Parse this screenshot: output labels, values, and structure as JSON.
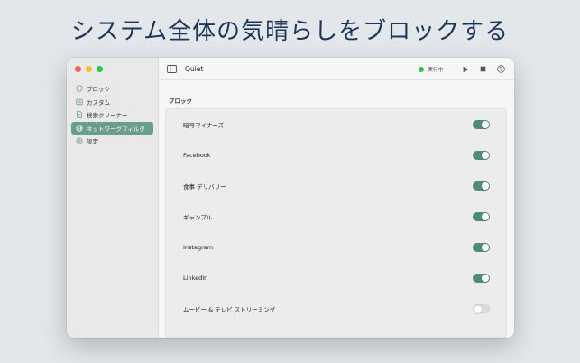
{
  "headline": "システム全体の気晴らしをブロックする",
  "colors": {
    "accent": "#6b9d8e",
    "toggle_on": "#4f8b7b",
    "status_running": "#2ec44a"
  },
  "sidebar": {
    "items": [
      {
        "label": "ブロック",
        "icon": "shield-icon"
      },
      {
        "label": "カスタム",
        "icon": "list-icon"
      },
      {
        "label": "検索クリーナー",
        "icon": "document-icon"
      },
      {
        "label": "ネットワークフィルタ",
        "icon": "globe-icon",
        "active": true
      },
      {
        "label": "設定",
        "icon": "gear-icon"
      }
    ]
  },
  "toolbar": {
    "title": "Quiet",
    "status": "実行中",
    "icons": [
      "sidebar-toggle-icon",
      "play-icon",
      "stop-icon",
      "help-icon"
    ]
  },
  "main": {
    "section_title": "ブロック",
    "rows": [
      {
        "label": "暗号マイナーズ",
        "on": true
      },
      {
        "label": "Facebook",
        "on": true
      },
      {
        "label": "食事 デリバリー",
        "on": true
      },
      {
        "label": "ギャンブル",
        "on": true
      },
      {
        "label": "Instagram",
        "on": true
      },
      {
        "label": "LinkedIn",
        "on": true
      },
      {
        "label": "ムービー & テレビ ストリーミング",
        "on": false
      }
    ]
  }
}
